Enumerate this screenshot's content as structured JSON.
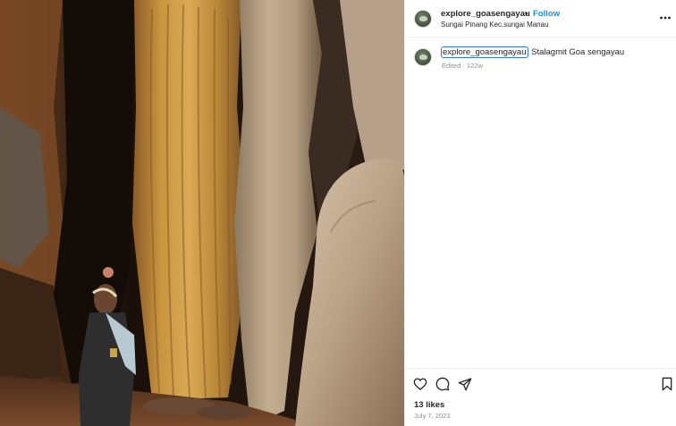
{
  "post": {
    "image": {
      "alt_semantic": "cave-photo"
    },
    "author": {
      "username": "explore_goasengayau",
      "follow_label": "Follow",
      "separator": "•",
      "location": "Sungai Pinang Kec.sungai Manau"
    },
    "caption": {
      "username": "explore_goasengayau",
      "text": " Stalagmit Goa sengayau",
      "meta": "Edited · 122w"
    },
    "stats": {
      "likes": "13 likes",
      "date": "July 7, 2023"
    },
    "icons": {
      "more": "more-options-icon",
      "like": "heart-icon",
      "comment": "comment-icon",
      "share": "share-icon",
      "save": "bookmark-icon"
    }
  },
  "colors": {
    "accent": "#0095f6",
    "text": "#262626",
    "muted": "#8e8e8e",
    "border": "#efefef",
    "focus_ring": "#3478d6"
  }
}
